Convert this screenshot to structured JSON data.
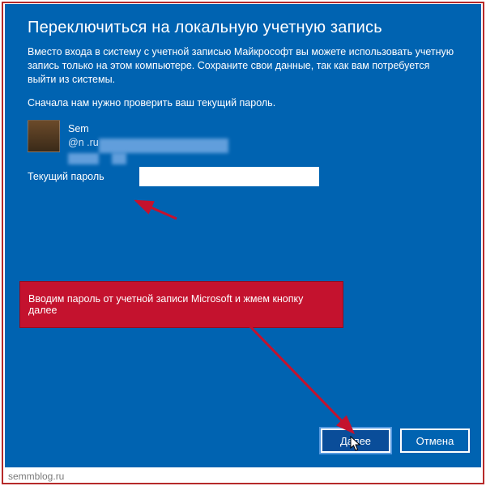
{
  "title": "Переключиться на локальную учетную запись",
  "description": "Вместо входа в систему с учетной записью Майкрософт вы можете использовать учетную запись только на этом компьютере. Сохраните свои данные, так как вам потребуется выйти из системы.",
  "description2": "Сначала нам нужно проверить ваш текущий пароль.",
  "user": {
    "name": "Sem",
    "email": "@n    .ru"
  },
  "password": {
    "label": "Текущий пароль",
    "value": ""
  },
  "callout": "Вводим пароль от учетной записи Microsoft и жмем кнопку далее",
  "buttons": {
    "next": "Далее",
    "cancel": "Отмена"
  },
  "watermark": "semmblog.ru",
  "colors": {
    "bg": "#0063b1",
    "accent_red": "#c4122e",
    "border_red": "#b62a2a"
  }
}
